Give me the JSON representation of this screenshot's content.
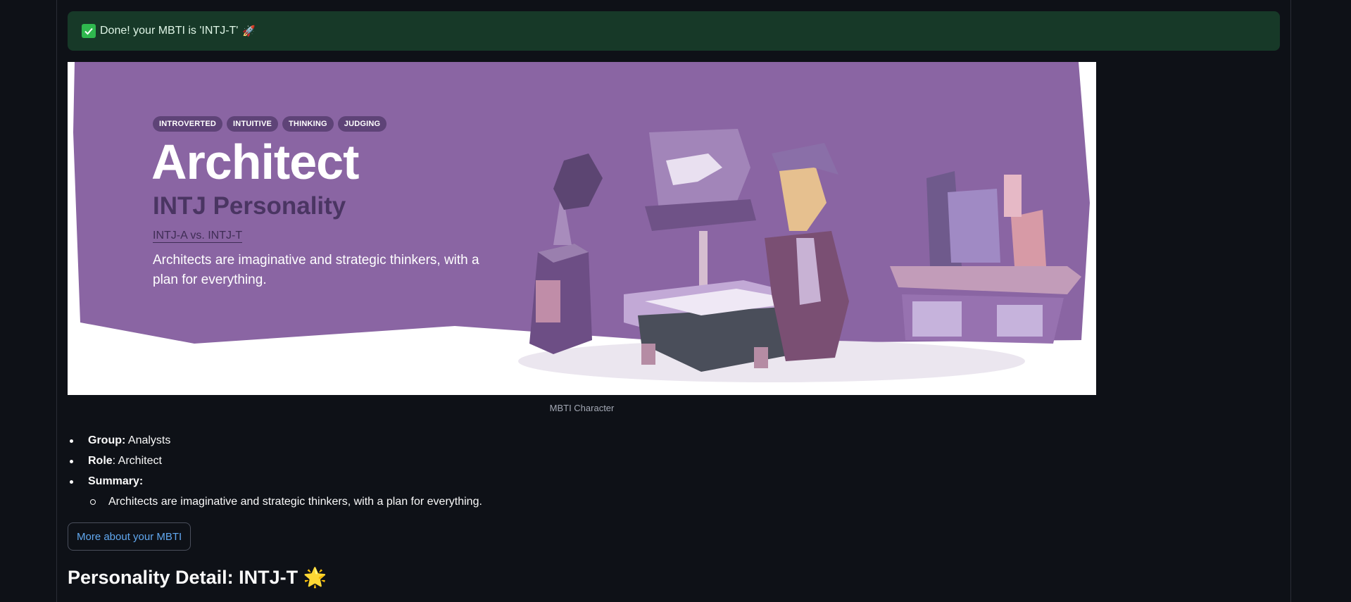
{
  "alert": {
    "text": "Done! your MBTI is 'INTJ-T'",
    "icon": "check-icon",
    "emoji": "🚀",
    "color": "#173928"
  },
  "banner": {
    "tags": [
      "INTROVERTED",
      "INTUITIVE",
      "THINKING",
      "JUDGING"
    ],
    "title": "Architect",
    "subtitle": "INTJ Personality",
    "link": "INTJ-A vs. INTJ-T",
    "description": "Architects are imaginative and strategic thinkers, with a plan for everything.",
    "accent": "#8a65a3"
  },
  "caption": "MBTI Character",
  "info": {
    "group_label": "Group:",
    "group_value": "Analysts",
    "role_label": "Role",
    "role_value": ": Architect",
    "summary_label": "Summary:",
    "summary_text": "Architects are imaginative and strategic thinkers, with a plan for everything."
  },
  "button": {
    "label": "More about your MBTI",
    "color": "#61a8f0"
  },
  "heading": {
    "text": "Personality Detail: INTJ-T",
    "emoji": "🌟"
  }
}
